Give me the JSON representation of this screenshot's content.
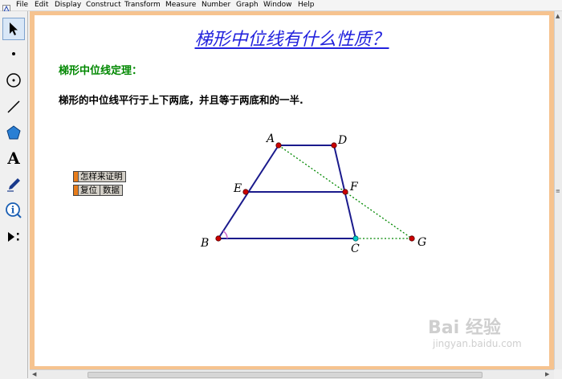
{
  "menu": [
    "File",
    "Edit",
    "Display",
    "Construct",
    "Transform",
    "Measure",
    "Number",
    "Graph",
    "Window",
    "Help"
  ],
  "tools": [
    {
      "name": "arrow-tool-icon"
    },
    {
      "name": "point-tool-icon"
    },
    {
      "name": "compass-tool-icon"
    },
    {
      "name": "straightedge-tool-icon"
    },
    {
      "name": "polygon-tool-icon"
    },
    {
      "name": "text-tool-icon",
      "glyph": "A"
    },
    {
      "name": "marker-tool-icon"
    },
    {
      "name": "information-tool-icon"
    },
    {
      "name": "custom-tool-icon"
    }
  ],
  "doc": {
    "title": "梯形中位线有什么性质？",
    "theorem_title": "梯形中位线定理：",
    "theorem_text": "梯形的中位线平行于上下两底，并且等于两底和的一半."
  },
  "buttons": {
    "prove": "怎样来证明",
    "reset": "复位",
    "data": "数据"
  },
  "figure": {
    "points": {
      "A": "A",
      "D": "D",
      "E": "E",
      "F": "F",
      "B": "B",
      "C": "C",
      "G": "G"
    },
    "colors": {
      "segment": "#1a1a8c",
      "point": "#cc0000",
      "point_c": "#00cccc",
      "dotted": "#008800",
      "angle_mark": "#cc66cc"
    }
  },
  "watermark": {
    "logo": "Bai 经验",
    "url": "jingyan.baidu.com"
  }
}
